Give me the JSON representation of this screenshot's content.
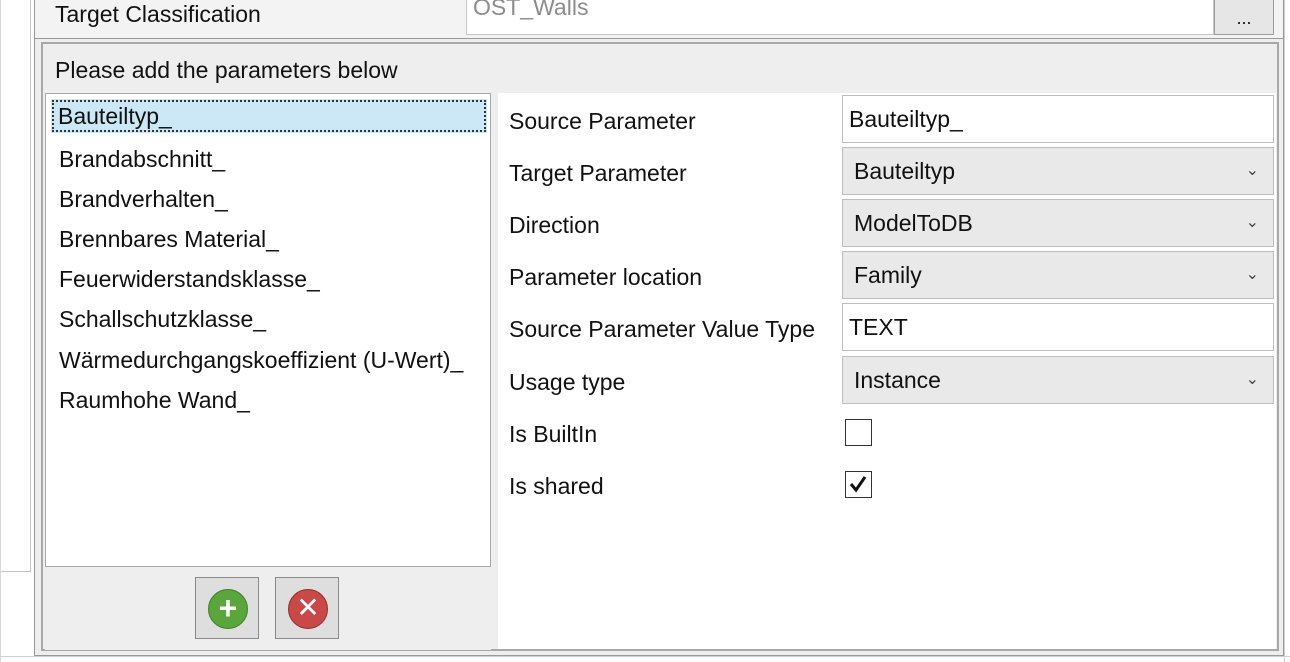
{
  "target": {
    "label": "Target Classification",
    "value": "OST_Walls",
    "browse_label": "..."
  },
  "instruction": "Please add the parameters below",
  "parameters": [
    "Bauteiltyp_",
    "Brandabschnitt_",
    "Brandverhalten_",
    "Brennbares Material_",
    "Feuerwiderstandsklasse_",
    "Schallschutzklasse_",
    "Wärmedurchgangskoeffizient (U-Wert)_",
    "Raumhohe Wand_"
  ],
  "buttons": {
    "add_icon": "plus-circle-icon",
    "delete_icon": "x-circle-icon"
  },
  "colors": {
    "add": "#5aa63c",
    "delete": "#c94848",
    "selection": "#cce8f7"
  },
  "details": {
    "source_parameter": {
      "label": "Source Parameter",
      "value": "Bauteiltyp_"
    },
    "target_parameter": {
      "label": "Target Parameter",
      "value": "Bauteiltyp"
    },
    "direction": {
      "label": "Direction",
      "value": "ModelToDB"
    },
    "parameter_location": {
      "label": "Parameter location",
      "value": "Family"
    },
    "value_type": {
      "label": "Source Parameter Value Type",
      "value": "TEXT"
    },
    "usage_type": {
      "label": "Usage type",
      "value": "Instance"
    },
    "is_builtin": {
      "label": "Is BuiltIn",
      "checked": false
    },
    "is_shared": {
      "label": "Is shared",
      "checked": true
    }
  }
}
